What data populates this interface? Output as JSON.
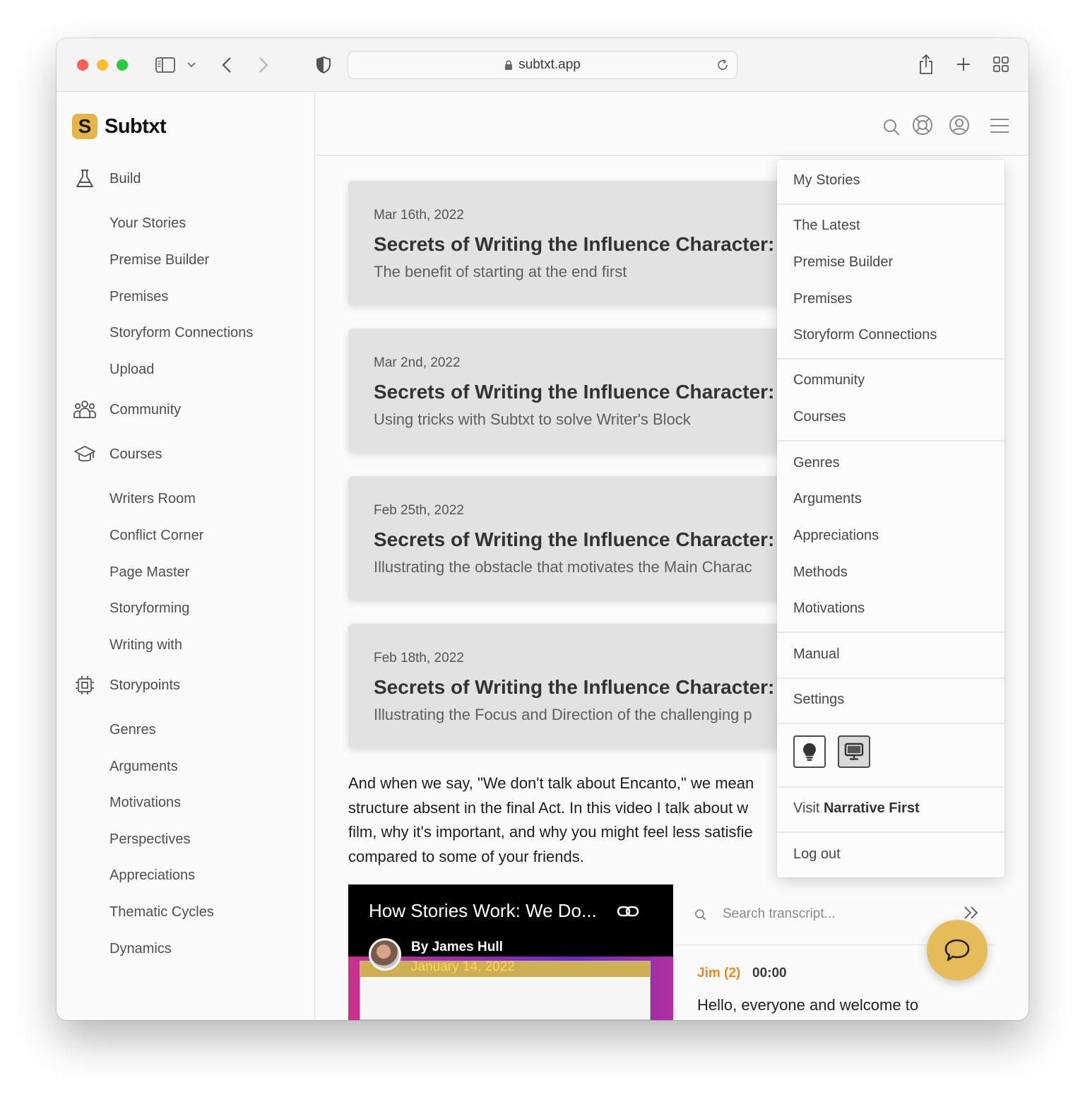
{
  "browser": {
    "url": "subtxt.app",
    "traffic_lights": {
      "close": "#fe5f57",
      "minimize": "#febc2e",
      "zoom": "#28c840"
    }
  },
  "brand": {
    "name": "Subtxt",
    "mark": "S",
    "accent": "#e6b54a"
  },
  "sidebar": {
    "sections": [
      {
        "label": "Build",
        "icon": "beaker-icon"
      },
      {
        "label": "Community",
        "icon": "people-icon"
      },
      {
        "label": "Courses",
        "icon": "graduation-cap-icon"
      },
      {
        "label": "Storypoints",
        "icon": "chip-icon"
      }
    ],
    "build_items": [
      "Your Stories",
      "Premise Builder",
      "Premises",
      "Storyform Connections",
      "Upload"
    ],
    "course_items": [
      "Writers Room",
      "Conflict Corner",
      "Page Master",
      "Storyforming",
      "Writing with"
    ],
    "storypoint_items": [
      "Genres",
      "Arguments",
      "Motivations",
      "Perspectives",
      "Appreciations",
      "Thematic Cycles",
      "Dynamics"
    ]
  },
  "cards": [
    {
      "date": "Mar 16th, 2022",
      "title": "Secrets of Writing the Influence Character: I",
      "subtitle": "The benefit of starting at the end first"
    },
    {
      "date": "Mar 2nd, 2022",
      "title": "Secrets of Writing the Influence Character: I",
      "subtitle": "Using tricks with Subtxt to solve Writer's Block"
    },
    {
      "date": "Feb 25th, 2022",
      "title": "Secrets of Writing the Influence Character: I",
      "subtitle": "Illustrating the obstacle that motivates the Main Charac"
    },
    {
      "date": "Feb 18th, 2022",
      "title": "Secrets of Writing the Influence Character: I",
      "subtitle": "Illustrating the Focus and Direction of the challenging p"
    }
  ],
  "paragraph": {
    "lines": [
      "And when we say, \"We don't talk about Encanto,\" we mean",
      "structure absent in the final Act. In this video I talk about w",
      "film, why it's important, and why you might feel less satisfie",
      "compared to some of your friends."
    ]
  },
  "video": {
    "title": "How Stories Work: We Do...",
    "author": "By James Hull",
    "date": "January 14, 2022"
  },
  "transcript": {
    "placeholder": "Search transcript...",
    "speaker": "Jim (2)",
    "time": "00:00",
    "text": "Hello, everyone and welcome to"
  },
  "menu": {
    "group1": [
      "My Stories"
    ],
    "group2": [
      "The Latest",
      "Premise Builder",
      "Premises",
      "Storyform Connections"
    ],
    "group3": [
      "Community",
      "Courses"
    ],
    "group4": [
      "Genres",
      "Arguments",
      "Appreciations",
      "Methods",
      "Motivations"
    ],
    "manual": "Manual",
    "settings": "Settings",
    "visit_prefix": "Visit",
    "visit_name": "Narrative First",
    "logout": "Log out"
  }
}
